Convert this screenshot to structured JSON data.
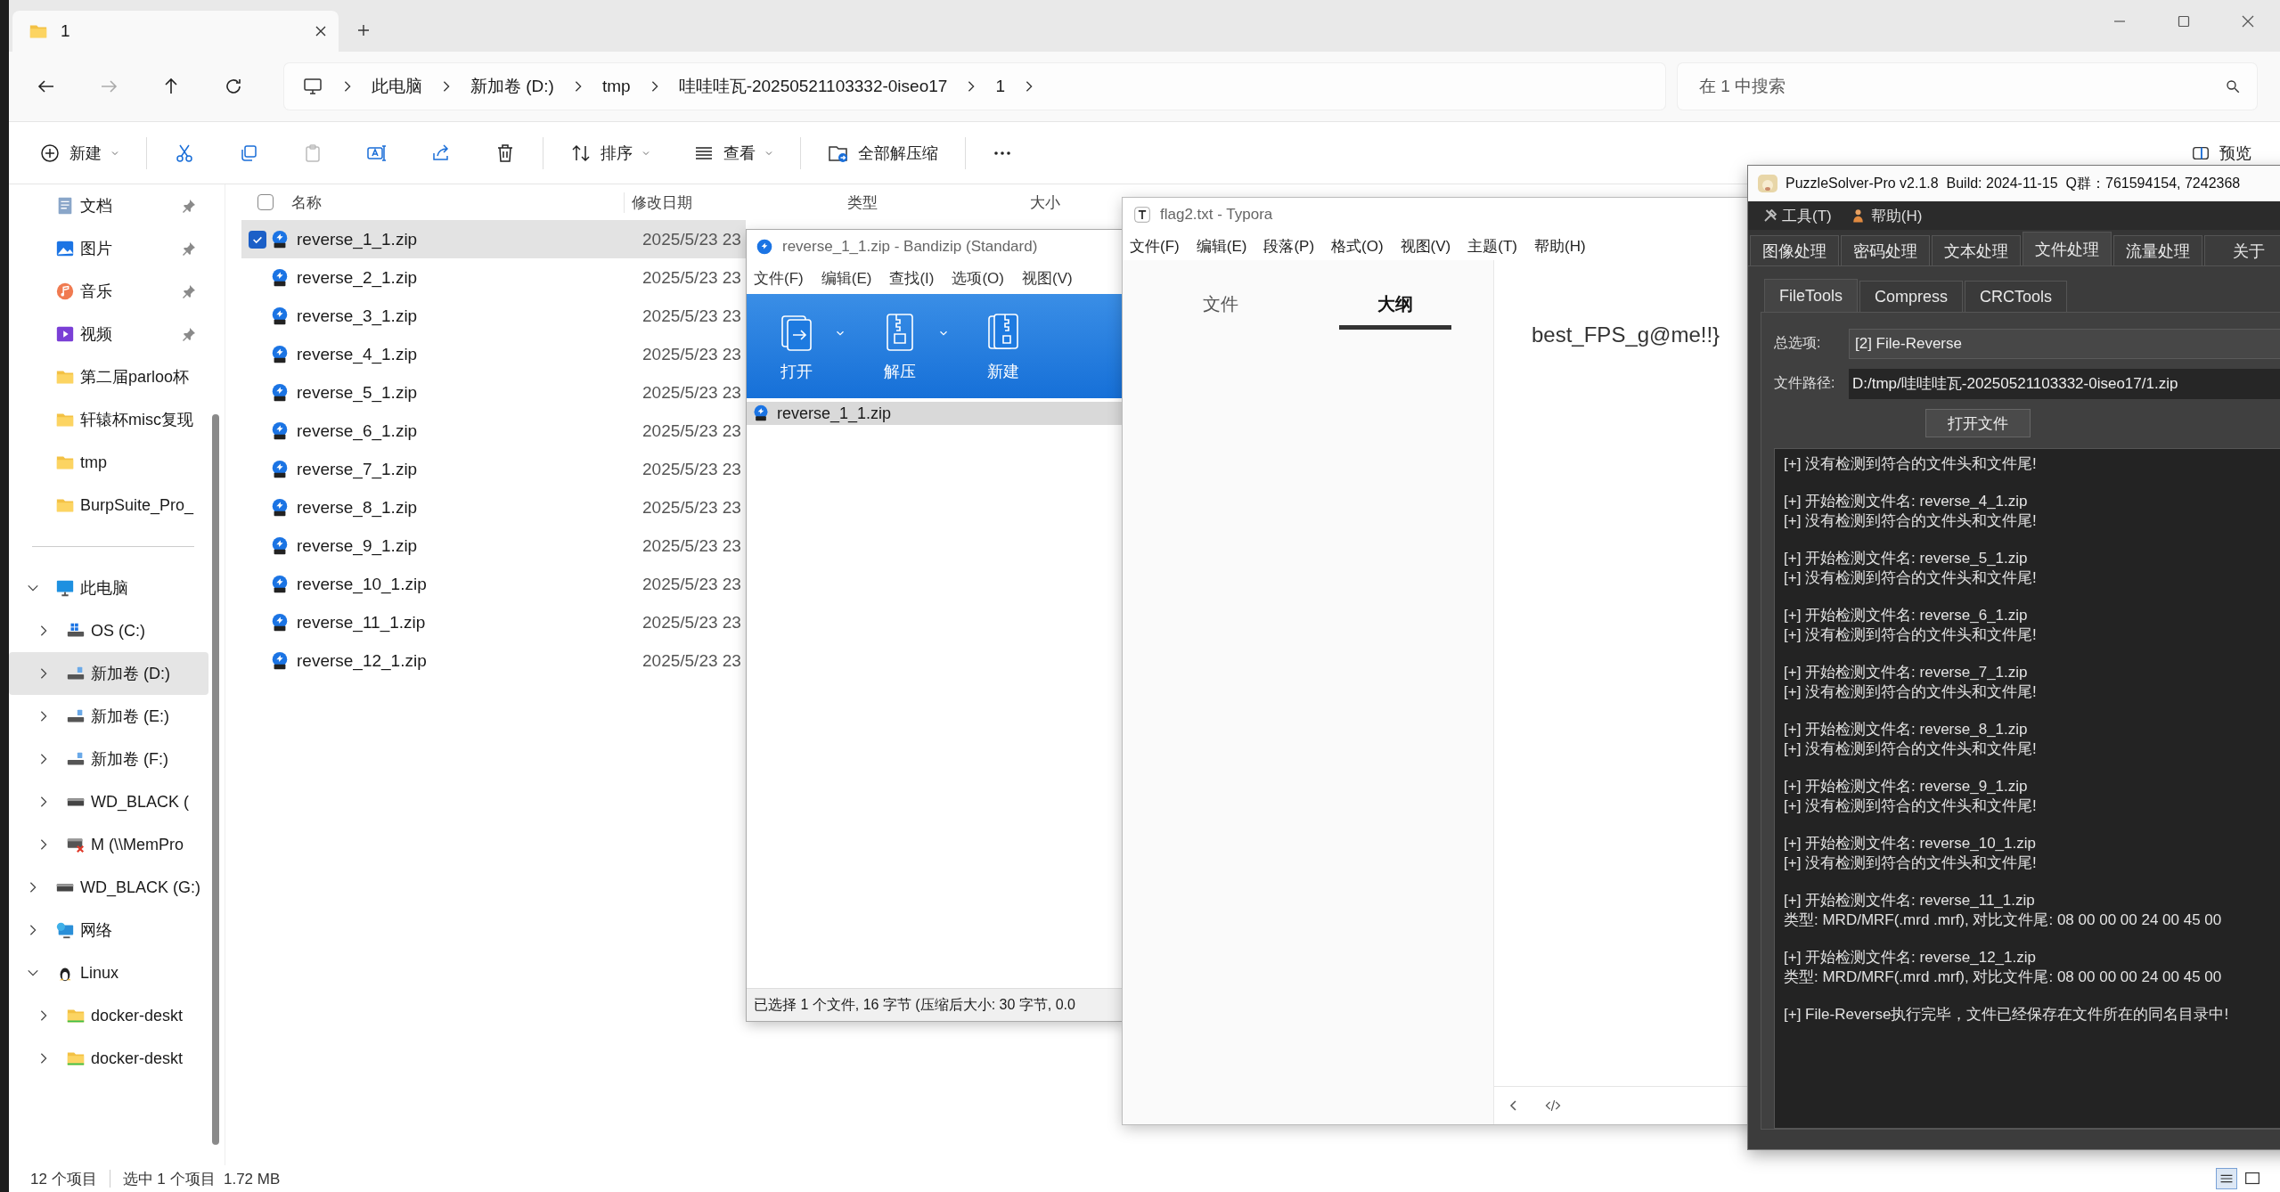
{
  "explorer": {
    "tab": {
      "title": "1"
    },
    "nav": [
      {
        "kind": "back",
        "disabled": false
      },
      {
        "kind": "forward",
        "disabled": true
      },
      {
        "kind": "up",
        "disabled": false
      },
      {
        "kind": "refresh",
        "disabled": false
      }
    ],
    "breadcrumb": [
      "此电脑",
      "新加卷 (D:)",
      "tmp",
      "哇哇哇瓦-20250521103332-0iseo17",
      "1"
    ],
    "search": {
      "placeholder": "在 1 中搜索"
    },
    "toolbar": [
      {
        "kind": "new",
        "label": "新建",
        "disabled": false
      },
      {
        "kind": "cut",
        "disabled": false
      },
      {
        "kind": "copy",
        "disabled": false
      },
      {
        "kind": "paste",
        "disabled": true
      },
      {
        "kind": "rename",
        "disabled": false
      },
      {
        "kind": "share",
        "disabled": false
      },
      {
        "kind": "delete",
        "disabled": false
      },
      {
        "kind": "sort",
        "label": "排序",
        "disabled": false
      },
      {
        "kind": "view",
        "label": "查看",
        "disabled": false
      },
      {
        "kind": "extract",
        "label": "全部解压缩",
        "disabled": false
      },
      {
        "kind": "more",
        "disabled": false
      }
    ],
    "preview": {
      "label": "预览"
    },
    "quick_access": [
      {
        "kind": "docs",
        "label": "文档",
        "pinned": true
      },
      {
        "kind": "pictures",
        "label": "图片",
        "pinned": true
      },
      {
        "kind": "music",
        "label": "音乐",
        "pinned": true
      },
      {
        "kind": "video",
        "label": "视频",
        "pinned": true
      },
      {
        "kind": "folder",
        "label": "第二届parloo杯",
        "pinned": false
      },
      {
        "kind": "folder",
        "label": "轩辕杯misc复现",
        "pinned": false
      },
      {
        "kind": "folder",
        "label": "tmp",
        "pinned": false
      },
      {
        "kind": "folder",
        "label": "BurpSuite_Pro_",
        "pinned": false
      }
    ],
    "tree": [
      {
        "kind": "pc",
        "label": "此电脑",
        "expanded": true,
        "selected": false,
        "children": [
          {
            "kind": "os",
            "label": "OS (C:)",
            "expanded": false,
            "selected": false
          },
          {
            "kind": "drive",
            "label": "新加卷 (D:)",
            "expanded": false,
            "selected": true
          },
          {
            "kind": "drive",
            "label": "新加卷 (E:)",
            "expanded": false,
            "selected": false
          },
          {
            "kind": "drive",
            "label": "新加卷 (F:)",
            "expanded": false,
            "selected": false
          },
          {
            "kind": "disk",
            "label": "WD_BLACK (",
            "expanded": false,
            "selected": false
          },
          {
            "kind": "netdrive",
            "label": "M (\\\\MemPro",
            "expanded": false,
            "selected": false
          }
        ]
      },
      {
        "kind": "disk",
        "label": "WD_BLACK (G:)",
        "expanded": false,
        "selected": false
      },
      {
        "kind": "network",
        "label": "网络",
        "expanded": false,
        "selected": false
      },
      {
        "kind": "linux",
        "label": "Linux",
        "expanded": true,
        "selected": false,
        "children": [
          {
            "kind": "linuxfolder",
            "label": "docker-deskt",
            "expanded": false,
            "selected": false
          },
          {
            "kind": "linuxfolder",
            "label": "docker-deskt",
            "expanded": false,
            "selected": false
          }
        ]
      }
    ],
    "select_all": {
      "checked": false
    },
    "columns": [
      "名称",
      "修改日期",
      "类型",
      "大小"
    ],
    "files": [
      {
        "name": "reverse_1_1.zip",
        "date": "2025/5/23 23",
        "selected": true
      },
      {
        "name": "reverse_2_1.zip",
        "date": "2025/5/23 23",
        "selected": false
      },
      {
        "name": "reverse_3_1.zip",
        "date": "2025/5/23 23",
        "selected": false
      },
      {
        "name": "reverse_4_1.zip",
        "date": "2025/5/23 23",
        "selected": false
      },
      {
        "name": "reverse_5_1.zip",
        "date": "2025/5/23 23",
        "selected": false
      },
      {
        "name": "reverse_6_1.zip",
        "date": "2025/5/23 23",
        "selected": false
      },
      {
        "name": "reverse_7_1.zip",
        "date": "2025/5/23 23",
        "selected": false
      },
      {
        "name": "reverse_8_1.zip",
        "date": "2025/5/23 23",
        "selected": false
      },
      {
        "name": "reverse_9_1.zip",
        "date": "2025/5/23 23",
        "selected": false
      },
      {
        "name": "reverse_10_1.zip",
        "date": "2025/5/23 23",
        "selected": false
      },
      {
        "name": "reverse_11_1.zip",
        "date": "2025/5/23 23",
        "selected": false
      },
      {
        "name": "reverse_12_1.zip",
        "date": "2025/5/23 23",
        "selected": false
      }
    ],
    "status": {
      "count": "12 个项目",
      "selection": "选中 1 个项目  1.72 MB"
    }
  },
  "bandizip": {
    "title": "reverse_1_1.zip - Bandizip (Standard)",
    "menu": [
      "文件(F)",
      "编辑(E)",
      "查找(I)",
      "选项(O)",
      "视图(V)"
    ],
    "toolbar": [
      {
        "kind": "open",
        "label": "打开",
        "dropdown": true
      },
      {
        "kind": "extract",
        "label": "解压",
        "dropdown": true
      },
      {
        "kind": "new",
        "label": "新建",
        "dropdown": false
      }
    ],
    "files": [
      {
        "name": "reverse_1_1.zip",
        "selected": true
      }
    ],
    "status": "已选择 1 个文件, 16 字节 (压缩后大小: 30 字节, 0.0"
  },
  "typora": {
    "title": "flag2.txt - Typora",
    "menu": [
      "文件(F)",
      "编辑(E)",
      "段落(P)",
      "格式(O)",
      "视图(V)",
      "主题(T)",
      "帮助(H)"
    ],
    "sidebar_tabs": [
      {
        "label": "文件",
        "selected": false
      },
      {
        "label": "大纲",
        "selected": true
      }
    ],
    "content": "best_FPS_g@me!!}"
  },
  "puzzlesolver": {
    "title": "PuzzleSolver-Pro v2.1.8  Build: 2024-11-15  Q群：761594154, 7242368",
    "menu": [
      {
        "kind": "tools",
        "label": "工具(T)"
      },
      {
        "kind": "help",
        "label": "帮助(H)"
      }
    ],
    "tabs": [
      {
        "label": "图像处理",
        "selected": false
      },
      {
        "label": "密码处理",
        "selected": false
      },
      {
        "label": "文本处理",
        "selected": false
      },
      {
        "label": "文件处理",
        "selected": true
      },
      {
        "label": "流量处理",
        "selected": false
      },
      {
        "label": "关于",
        "selected": false
      }
    ],
    "subtabs": [
      {
        "label": "FileTools",
        "selected": true
      },
      {
        "label": "Compress",
        "selected": false
      },
      {
        "label": "CRCTools",
        "selected": false
      }
    ],
    "fields": [
      {
        "kind": "combo",
        "label": "总选项:",
        "value": "[2] File-Reverse"
      },
      {
        "kind": "text",
        "label": "文件路径:",
        "value": "D:/tmp/哇哇哇瓦-20250521103332-0iseo17/1.zip"
      }
    ],
    "button": "打开文件",
    "log": [
      [
        "[+] 没有检测到符合的文件头和文件尾!"
      ],
      [
        "[+] 开始检测文件名: reverse_4_1.zip",
        "[+] 没有检测到符合的文件头和文件尾!"
      ],
      [
        "[+] 开始检测文件名: reverse_5_1.zip",
        "[+] 没有检测到符合的文件头和文件尾!"
      ],
      [
        "[+] 开始检测文件名: reverse_6_1.zip",
        "[+] 没有检测到符合的文件头和文件尾!"
      ],
      [
        "[+] 开始检测文件名: reverse_7_1.zip",
        "[+] 没有检测到符合的文件头和文件尾!"
      ],
      [
        "[+] 开始检测文件名: reverse_8_1.zip",
        "[+] 没有检测到符合的文件头和文件尾!"
      ],
      [
        "[+] 开始检测文件名: reverse_9_1.zip",
        "[+] 没有检测到符合的文件头和文件尾!"
      ],
      [
        "[+] 开始检测文件名: reverse_10_1.zip",
        "[+] 没有检测到符合的文件头和文件尾!"
      ],
      [
        "[+] 开始检测文件名: reverse_11_1.zip",
        "类型: MRD/MRF(.mrd .mrf), 对比文件尾: 08 00 00 00 24 00 45 00"
      ],
      [
        "[+] 开始检测文件名: reverse_12_1.zip",
        "类型: MRD/MRF(.mrd .mrf), 对比文件尾: 08 00 00 00 24 00 45 00"
      ],
      [
        "[+] File-Reverse执行完毕，文件已经保存在文件所在的同名目录中!"
      ]
    ]
  }
}
